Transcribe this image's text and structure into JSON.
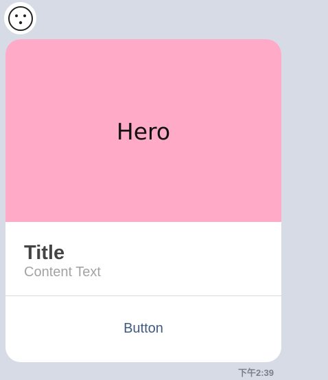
{
  "message": {
    "avatar_icon": "face-icon",
    "hero": {
      "text": "Hero",
      "background": "#ffaac6"
    },
    "title": "Title",
    "content_text": "Content Text",
    "button_label": "Button",
    "button_color": "#3e5a7e",
    "timestamp": "下午2:39"
  },
  "colors": {
    "chat_background": "#d6dbe5",
    "bubble_background": "#ffffff"
  }
}
